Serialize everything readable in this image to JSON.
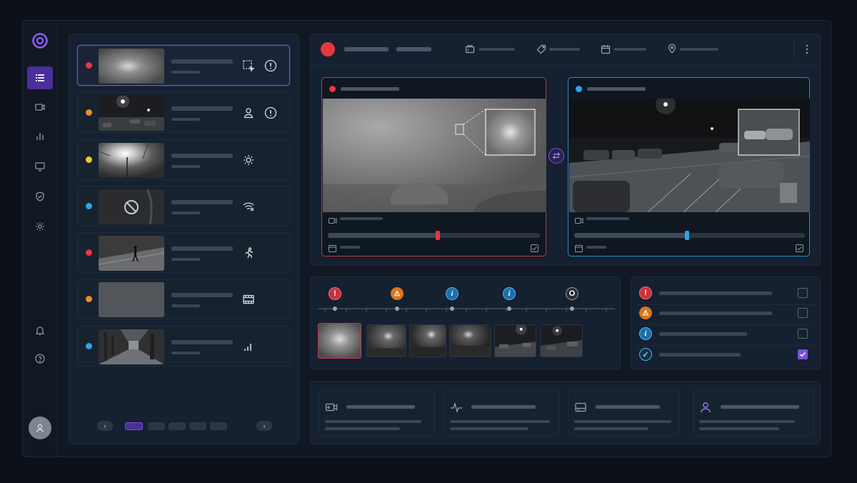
{
  "colors": {
    "accent": "#7b4fe0",
    "red": "#e5393f",
    "orange": "#f08a2c",
    "yellow": "#f0c52c",
    "blue": "#2ea4e8",
    "grey": "#8a95a3"
  },
  "nav": {
    "items": [
      {
        "icon": "list-icon",
        "active": true
      },
      {
        "icon": "camera-icon",
        "active": false
      },
      {
        "icon": "chart-icon",
        "active": false
      },
      {
        "icon": "monitor-icon",
        "active": false
      },
      {
        "icon": "shield-icon",
        "active": false
      },
      {
        "icon": "gear-icon",
        "active": false
      }
    ],
    "bottom": [
      "bell-icon",
      "help-icon"
    ]
  },
  "cameras": [
    {
      "status": "red",
      "thumb": "fog",
      "icons": [
        "select-zone-icon",
        "alert-icon"
      ],
      "selected": true
    },
    {
      "status": "orange",
      "thumb": "night-lot",
      "icons": [
        "person-icon",
        "alert-icon"
      ]
    },
    {
      "status": "yellow",
      "thumb": "glare",
      "icons": [
        "sun-icon"
      ]
    },
    {
      "status": "blue",
      "thumb": "blocked",
      "icons": [
        "wifi-off-icon"
      ]
    },
    {
      "status": "red",
      "thumb": "walker",
      "icons": [
        "running-person-icon"
      ]
    },
    {
      "status": "orange",
      "thumb": "noise",
      "icons": [
        "film-icon"
      ]
    },
    {
      "status": "blue",
      "thumb": "corridor",
      "icons": [
        "signal-bars-icon"
      ]
    }
  ],
  "pagination": {
    "pages": 5,
    "current": 1
  },
  "header": {
    "icons": [
      "folder-icon",
      "tag-icon",
      "calendar-icon",
      "location-icon",
      "more-icon"
    ]
  },
  "feeds": [
    {
      "status": "red",
      "progress": 0.52
    },
    {
      "status": "blue",
      "progress": 0.49
    }
  ],
  "timeline": {
    "events": [
      {
        "severity": "critical",
        "symbol": "!"
      },
      {
        "severity": "warning",
        "symbol": "⚠"
      },
      {
        "severity": "info",
        "symbol": "i"
      },
      {
        "severity": "info",
        "symbol": "i"
      },
      {
        "severity": "neutral",
        "symbol": "O"
      }
    ]
  },
  "checklist": [
    {
      "severity": "critical",
      "symbol": "!",
      "checked": false
    },
    {
      "severity": "warning",
      "symbol": "⚠",
      "checked": false
    },
    {
      "severity": "info",
      "symbol": "i",
      "checked": false
    },
    {
      "severity": "ok",
      "symbol": "✓",
      "checked": true
    }
  ],
  "stats": [
    {
      "icon": "camera-icon"
    },
    {
      "icon": "activity-icon"
    },
    {
      "icon": "storage-icon"
    },
    {
      "icon": "user-icon"
    }
  ]
}
